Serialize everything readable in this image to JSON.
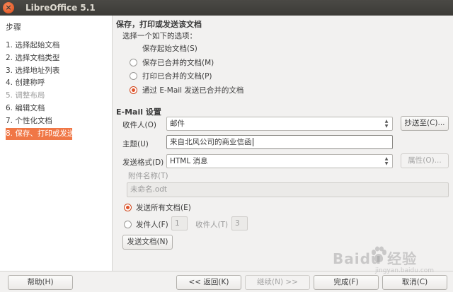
{
  "window": {
    "title": "LibreOffice 5.1",
    "close_glyph": "×"
  },
  "sidebar": {
    "title": "步骤",
    "items": [
      {
        "label": "1. 选择起始文档",
        "state": "normal"
      },
      {
        "label": "2. 选择文档类型",
        "state": "normal"
      },
      {
        "label": "3. 选择地址列表",
        "state": "normal"
      },
      {
        "label": "4. 创建称呼",
        "state": "normal"
      },
      {
        "label": "5. 调整布局",
        "state": "disabled"
      },
      {
        "label": "6. 编辑文档",
        "state": "normal"
      },
      {
        "label": "7. 个性化文档",
        "state": "normal"
      },
      {
        "label": "8. 保存、打印或发送",
        "state": "active"
      }
    ]
  },
  "main": {
    "heading": "保存，打印或发送该文档",
    "choose_prompt": "选择一个如下的选项：",
    "save_starting_doc": "保存起始文档(S)",
    "options": [
      {
        "label": "保存已合并的文档(M)",
        "checked": false
      },
      {
        "label": "打印已合并的文档(P)",
        "checked": false
      },
      {
        "label": "通过 E-Mail 发送已合并的文档",
        "checked": true
      }
    ],
    "email_heading": "E-Mail 设置",
    "to": {
      "label": "收件人(O)",
      "value": "邮件",
      "copy_to_button": "抄送至(C)..."
    },
    "subject": {
      "label": "主题(U)",
      "value": "来自北风公司的商业信函"
    },
    "send_format": {
      "label": "发送格式(D)",
      "value": "HTML 消息",
      "properties_button": "属性(O)..."
    },
    "attachment": {
      "label": "附件名称(T)",
      "value": "未命名.odt"
    },
    "send_all": {
      "label": "发送所有文档(E)",
      "checked": true
    },
    "send_range": {
      "from_label": "发件人(F)",
      "from_value": "1",
      "to_label": "收件人(T)",
      "to_value": "3",
      "checked": false
    },
    "send_docs_button": "发送文档(N)"
  },
  "footer": {
    "help": "帮助(H)",
    "back": "<< 返回(K)",
    "next": "继续(N) >>",
    "finish": "完成(F)",
    "cancel": "取消(C)"
  },
  "watermark": {
    "text": "Baidu 经验",
    "sub": "jingyan.baidu.com"
  },
  "colors": {
    "accent": "#f07746",
    "titlebar": "#3c3b37",
    "radio_checked": "#e0532a"
  }
}
